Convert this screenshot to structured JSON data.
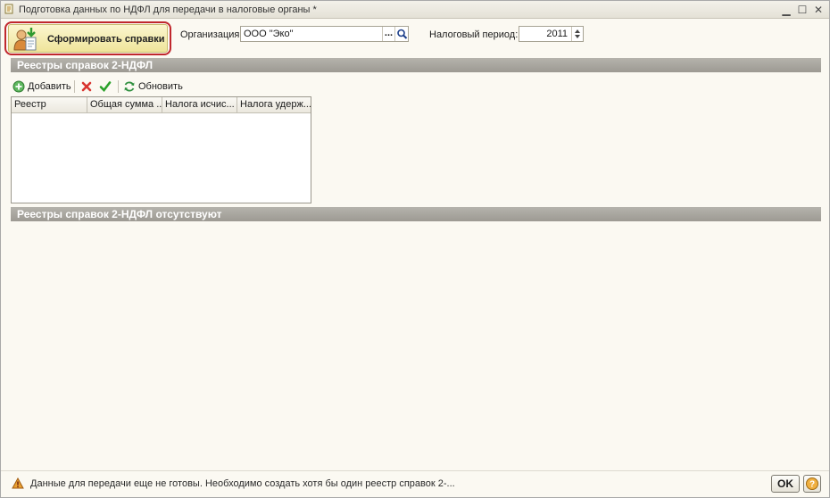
{
  "window": {
    "title": "Подготовка данных по НДФЛ для передачи в налоговые органы *",
    "controls": [
      "minimize-icon",
      "maximize-icon",
      "close-icon"
    ]
  },
  "toolbar": {
    "generate_label": "Сформировать справки",
    "organization_label": "Организация:",
    "organization_value": "ООО \"Эко\"",
    "organization_select": "...",
    "period_label": "Налоговый период:",
    "period_value": "2011"
  },
  "registers": {
    "section_title": "Реестры справок 2-НДФЛ",
    "commands": {
      "add_label": "Добавить",
      "refresh_label": "Обновить"
    },
    "columns": [
      "Реестр",
      "Общая сумма ...",
      "Налога исчис...",
      "Налога удерж..."
    ]
  },
  "empty_section": {
    "title": "Реестры справок 2-НДФЛ отсутствуют"
  },
  "status": {
    "message": "Данные для передачи еще не готовы. Необходимо создать хотя бы один реестр справок 2-...",
    "ok_label": "OK"
  },
  "colors": {
    "window_background": "#fbf9f2",
    "section_bar": "#a9a69f",
    "highlight_ring": "#c0272d",
    "primary_button": "#f3eab0"
  }
}
